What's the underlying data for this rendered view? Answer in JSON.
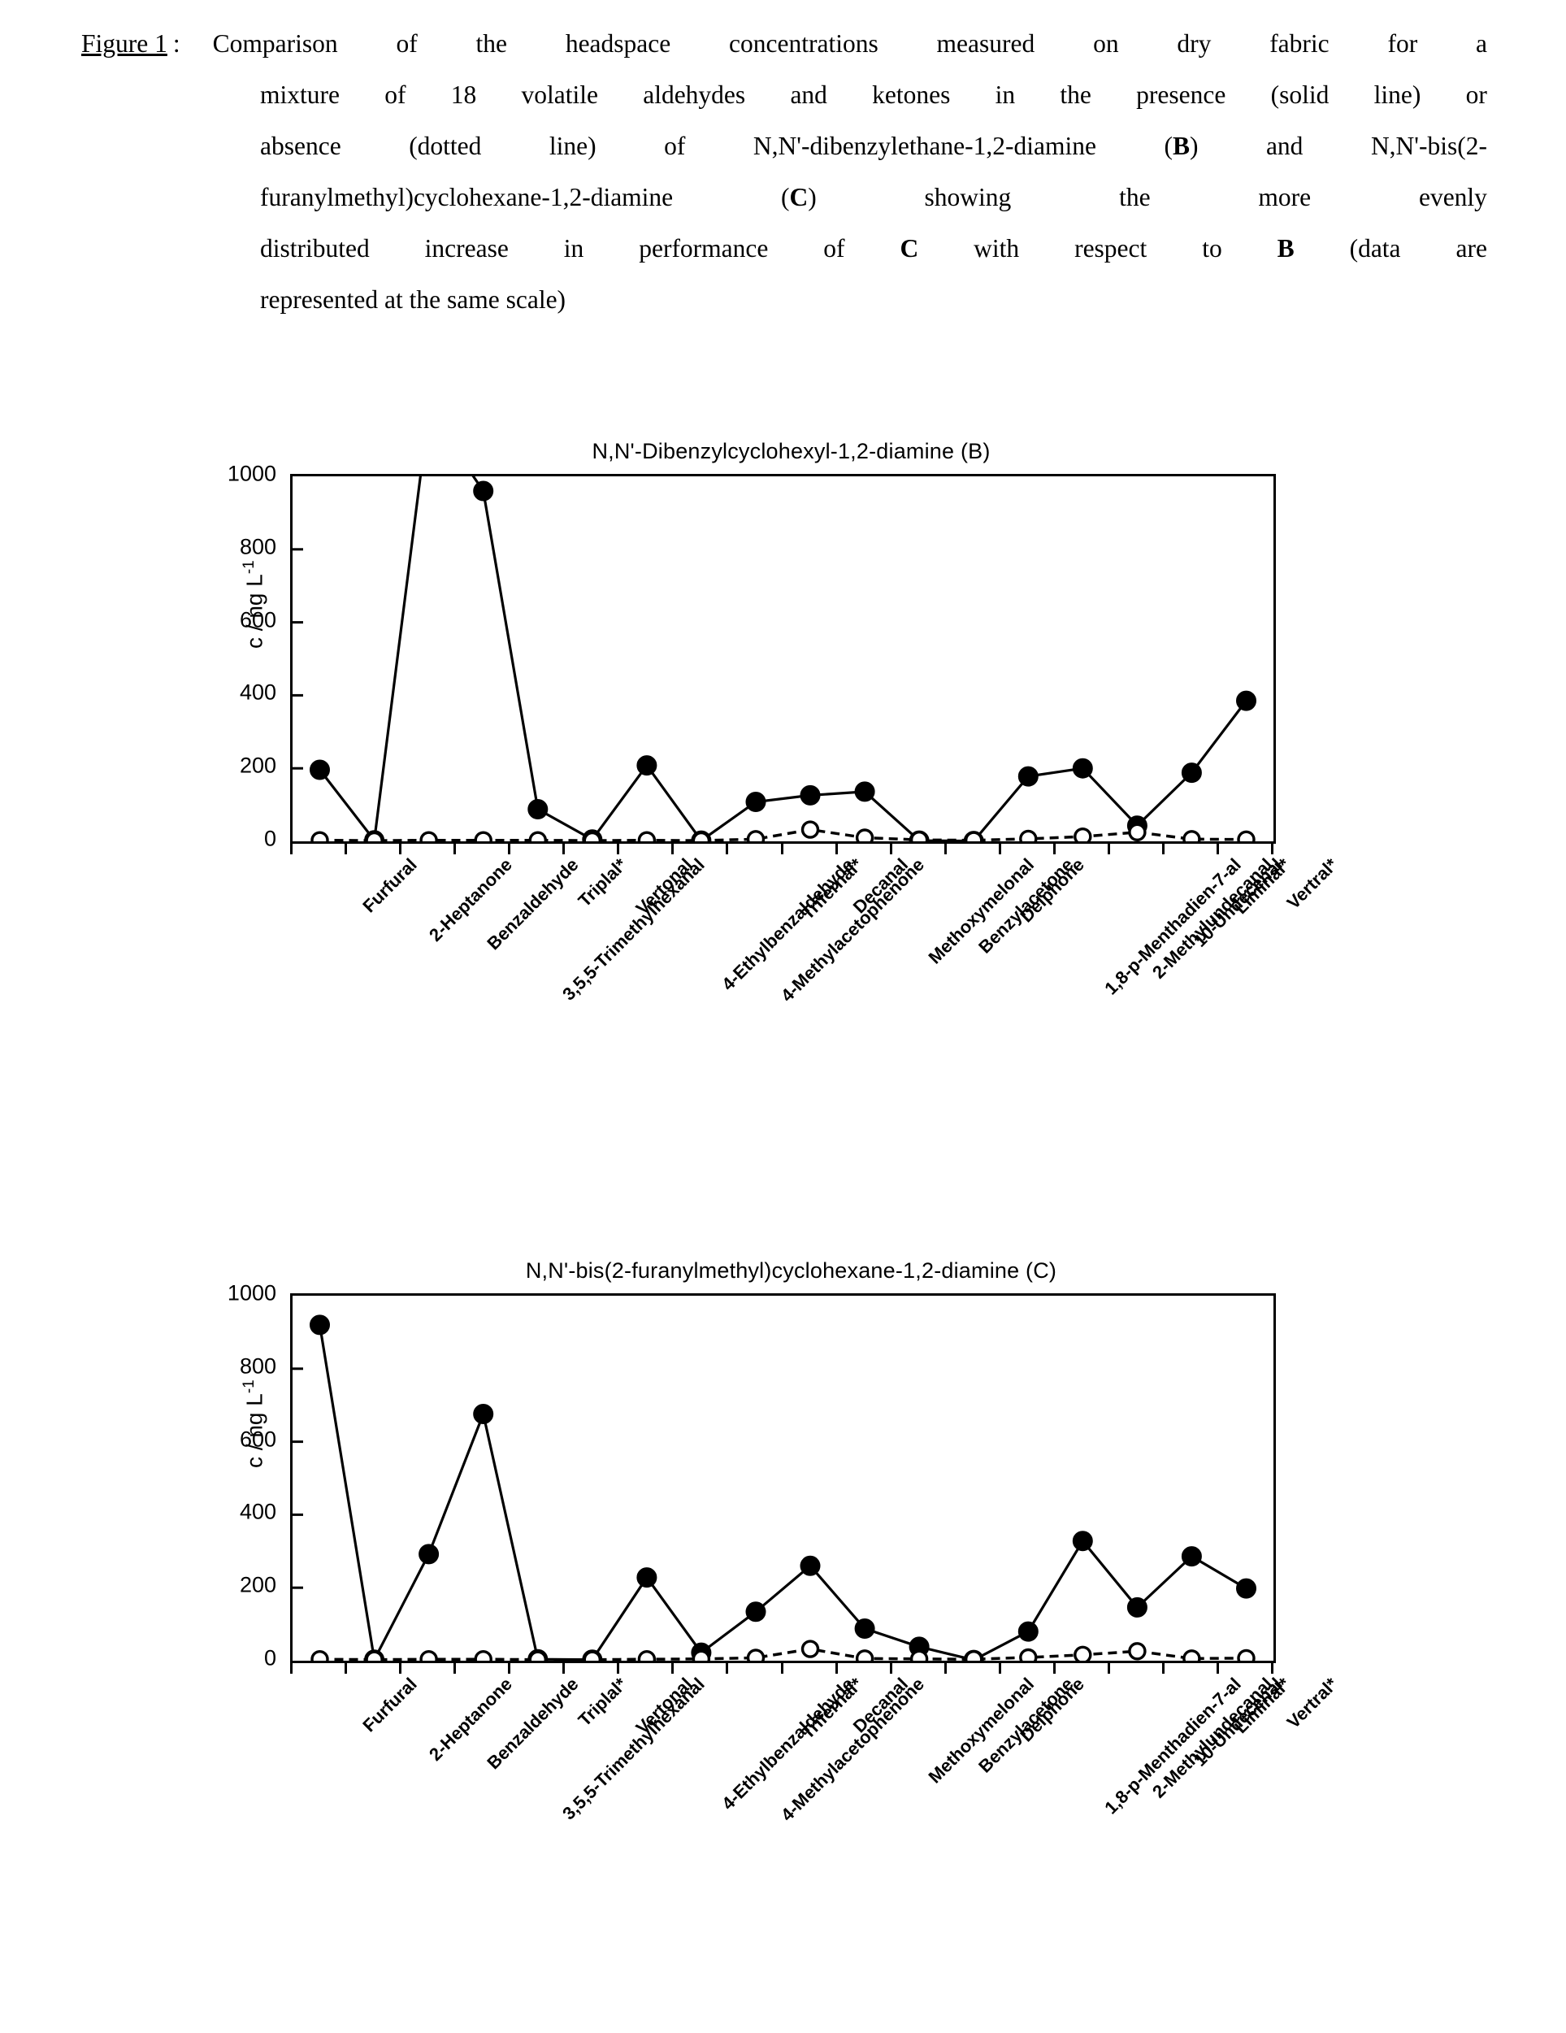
{
  "caption": {
    "label": "Figure 1",
    "colon": ":",
    "lines": [
      [
        "Comparison",
        "of",
        "the",
        "headspace",
        "concentrations",
        "measured",
        "on",
        "dry",
        "fabric",
        "for",
        "a"
      ],
      [
        "mixture",
        "of",
        "18",
        "volatile",
        "aldehydes",
        "and",
        "ketones",
        "in",
        "the",
        "presence",
        "(solid",
        "line)",
        "or"
      ],
      [
        "absence",
        "(dotted",
        "line)",
        "of",
        "N,N'-dibenzylethane-1,2-diamine",
        "(B)",
        "and",
        "N,N'-bis(2-"
      ],
      [
        "furanylmethyl)cyclohexane-1,2-diamine",
        "(C)",
        "showing",
        "the",
        "more",
        "evenly"
      ],
      [
        "distributed",
        "increase",
        "in",
        "performance",
        "of",
        "C",
        "with",
        "respect",
        "to",
        "B",
        "(data",
        "are"
      ],
      [
        "represented at the same scale)"
      ]
    ]
  },
  "axis": {
    "ylabel_prefix": "c / ng L",
    "ylabel_exponent": "-1",
    "yticks": [
      "1000",
      "800",
      "600",
      "400",
      "200",
      "0"
    ]
  },
  "chart_data": [
    {
      "id": "B",
      "type": "line",
      "title": "N,N'-Dibenzylcyclohexyl-1,2-diamine (B)",
      "xlabel": "",
      "ylabel": "c / ng L-1",
      "ylim": [
        0,
        1000
      ],
      "yticks": [
        0,
        200,
        400,
        600,
        800,
        1000
      ],
      "grid": false,
      "legend": "none",
      "categories": [
        "Furfural",
        "2-Heptanone",
        "Benzaldehyde",
        "3,5,5-Trimethylhexanal",
        "Triplal*",
        "Vertonal",
        "4-Ethylbenzaldehyde",
        "4-Methylacetophenone",
        "Trifernal*",
        "Decanal",
        "Methoxymelonal",
        "Benzylacetone",
        "Delphone",
        "1,8-p-Menthadien-7-al",
        "2-Methylundecanal",
        "10-Undecenal",
        "Liminal*",
        "Vertral*"
      ],
      "series": [
        {
          "name": "presence of amine (solid line, filled circles)",
          "style": "solid",
          "marker": "filled-circle",
          "values": [
            196,
            3,
            1180,
            960,
            88,
            5,
            208,
            2,
            108,
            126,
            136,
            2,
            1,
            178,
            200,
            43,
            188,
            385
          ],
          "clipped_indices": [
            2
          ],
          "note": "Benzaldehyde exceeds the 1000 ng/L axis maximum and is drawn clipped at the top"
        },
        {
          "name": "absence of amine (dotted line, open circles)",
          "style": "dotted",
          "marker": "open-circle",
          "values": [
            3,
            2,
            3,
            3,
            3,
            2,
            3,
            2,
            6,
            32,
            10,
            4,
            3,
            7,
            13,
            25,
            6,
            5
          ]
        }
      ]
    },
    {
      "id": "C",
      "type": "line",
      "title": "N,N'-bis(2-furanylmethyl)cyclohexane-1,2-diamine (C)",
      "xlabel": "",
      "ylabel": "c / ng L-1",
      "ylim": [
        0,
        1000
      ],
      "yticks": [
        0,
        200,
        400,
        600,
        800,
        1000
      ],
      "grid": false,
      "legend": "none",
      "categories": [
        "Furfural",
        "2-Heptanone",
        "Benzaldehyde",
        "3,5,5-Trimethylhexanal",
        "Triplal*",
        "Vertonal",
        "4-Ethylbenzaldehyde",
        "4-Methylacetophenone",
        "Trifernal*",
        "Decanal",
        "Methoxymelonal",
        "Benzylacetone",
        "Delphone",
        "1,8-p-Menthadien-7-al",
        "2-Methylundecanal",
        "10-Undecenal",
        "Liminal*",
        "Vertral*"
      ],
      "series": [
        {
          "name": "presence of amine (solid line, filled circles)",
          "style": "solid",
          "marker": "filled-circle",
          "values": [
            920,
            3,
            292,
            676,
            4,
            3,
            228,
            22,
            134,
            260,
            88,
            38,
            2,
            80,
            328,
            146,
            286,
            198
          ]
        },
        {
          "name": "absence of amine (dotted line, open circles)",
          "style": "dotted",
          "marker": "open-circle",
          "values": [
            4,
            3,
            4,
            4,
            3,
            3,
            4,
            5,
            8,
            32,
            6,
            5,
            4,
            9,
            16,
            26,
            6,
            7
          ]
        }
      ]
    }
  ]
}
